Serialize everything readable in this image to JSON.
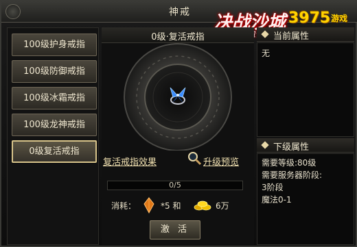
{
  "window": {
    "title": "神戒"
  },
  "logo": {
    "game_name": "决战沙城",
    "sub_name": "热血传说",
    "brand": "3975",
    "brand_suffix": "游戏"
  },
  "ring_list": [
    {
      "label": "100级护身戒指",
      "selected": false
    },
    {
      "label": "100级防御戒指",
      "selected": false
    },
    {
      "label": "100级冰霜戒指",
      "selected": false
    },
    {
      "label": "100级龙神戒指",
      "selected": false
    },
    {
      "label": "0级复活戒指",
      "selected": true
    }
  ],
  "center": {
    "ring_title": "0级·复活戒指",
    "effect_link": "复活戒指效果",
    "preview_link": "升级预览",
    "progress_text": "0/5",
    "progress_value": 0,
    "cost_label": "消耗：",
    "cost_gem": "*5 和",
    "cost_gold": "6万",
    "activate_label": "激 活"
  },
  "current_attrs": {
    "header": "当前属性",
    "lines": [
      "无"
    ]
  },
  "next_attrs": {
    "header": "下级属性",
    "lines": [
      "需要等级:80级",
      "需要服务器阶段:",
      "3阶段",
      "魔法0-1"
    ]
  },
  "colors": {
    "text": "#f0e8d0",
    "border_gold": "#d8c48a",
    "gem_blue": "#3a8cff",
    "gold_coin": "#f0c000",
    "logo_red": "#cc0000",
    "brand_yellow": "#ffd400"
  },
  "icons": {
    "close": "close-icon",
    "gem": "orange-crystal-icon",
    "gold": "gold-ingot-icon",
    "search": "magnifier-icon",
    "ring": "blue-butterfly-ring-icon"
  }
}
